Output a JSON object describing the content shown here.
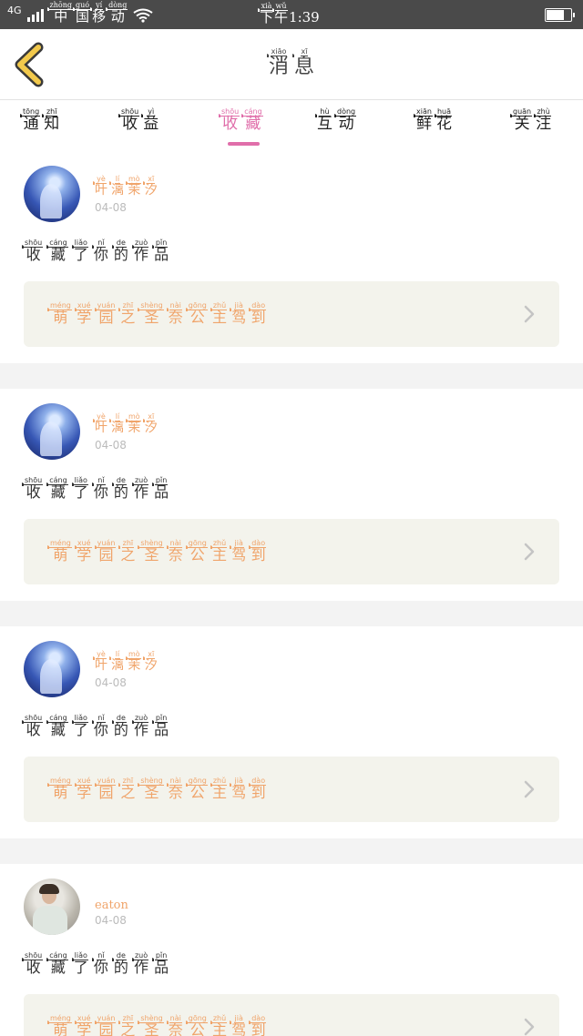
{
  "status_bar": {
    "network": "4G",
    "carrier": [
      {
        "py": "zhōng",
        "hz": "中"
      },
      {
        "py": "guó",
        "hz": "国"
      },
      {
        "py": "yí",
        "hz": "移"
      },
      {
        "py": "dòng",
        "hz": "动"
      }
    ],
    "time_prefix": [
      {
        "py": "xià",
        "hz": "下"
      },
      {
        "py": "wǔ",
        "hz": "午"
      }
    ],
    "time": "1:39",
    "battery_level": 0.75,
    "icons": [
      "signal-icon",
      "wifi-icon",
      "battery-icon"
    ]
  },
  "header": {
    "title": [
      {
        "py": "xiāo",
        "hz": "消"
      },
      {
        "py": "xī",
        "hz": "息"
      }
    ],
    "back_icon": "chevron-left-icon",
    "back_color": "#f2c94c"
  },
  "tabs": [
    {
      "id": "notice",
      "chars": [
        {
          "py": "tōng",
          "hz": "通"
        },
        {
          "py": "zhī",
          "hz": "知"
        }
      ]
    },
    {
      "id": "income",
      "chars": [
        {
          "py": "shōu",
          "hz": "收"
        },
        {
          "py": "yì",
          "hz": "益"
        }
      ]
    },
    {
      "id": "favorite",
      "active": true,
      "chars": [
        {
          "py": "shōu",
          "hz": "收"
        },
        {
          "py": "cáng",
          "hz": "藏"
        }
      ]
    },
    {
      "id": "interaction",
      "chars": [
        {
          "py": "hù",
          "hz": "互"
        },
        {
          "py": "dòng",
          "hz": "动"
        }
      ]
    },
    {
      "id": "flowers",
      "chars": [
        {
          "py": "xiān",
          "hz": "鲜"
        },
        {
          "py": "huā",
          "hz": "花"
        }
      ]
    },
    {
      "id": "follow",
      "chars": [
        {
          "py": "guān",
          "hz": "关"
        },
        {
          "py": "zhù",
          "hz": "注"
        }
      ]
    }
  ],
  "colors": {
    "accent": "#e06eaa",
    "name": "#f0a46a",
    "card_bg": "#f3f3ec",
    "status_bar": "#4a4a4a"
  },
  "feed": [
    {
      "avatar": "night-avatar",
      "user_chars": [
        {
          "py": "yè",
          "hz": "叶"
        },
        {
          "py": "lí",
          "hz": "漓"
        },
        {
          "py": "mò",
          "hz": "茉"
        },
        {
          "py": "xī",
          "hz": "汐"
        }
      ],
      "date": "04-08",
      "action_chars": [
        {
          "py": "shōu",
          "hz": "收"
        },
        {
          "py": "cáng",
          "hz": "藏"
        },
        {
          "py": "liǎo",
          "hz": "了"
        },
        {
          "py": "nǐ",
          "hz": "你"
        },
        {
          "py": "de",
          "hz": "的"
        },
        {
          "py": "zuò",
          "hz": "作"
        },
        {
          "py": "pǐn",
          "hz": "品"
        }
      ],
      "work_chars": [
        {
          "py": "méng",
          "hz": "萌"
        },
        {
          "py": "xué",
          "hz": "学"
        },
        {
          "py": "yuán",
          "hz": "园"
        },
        {
          "py": "zhī",
          "hz": "之"
        },
        {
          "py": "shèng",
          "hz": "圣"
        },
        {
          "py": "nài",
          "hz": "奈"
        },
        {
          "py": "gōng",
          "hz": "公"
        },
        {
          "py": "zhǔ",
          "hz": "主"
        },
        {
          "py": "jià",
          "hz": "驾"
        },
        {
          "py": "dào",
          "hz": "到"
        }
      ]
    },
    {
      "avatar": "night-avatar",
      "user_chars": [
        {
          "py": "yè",
          "hz": "叶"
        },
        {
          "py": "lí",
          "hz": "漓"
        },
        {
          "py": "mò",
          "hz": "茉"
        },
        {
          "py": "xī",
          "hz": "汐"
        }
      ],
      "date": "04-08",
      "action_chars": [
        {
          "py": "shōu",
          "hz": "收"
        },
        {
          "py": "cáng",
          "hz": "藏"
        },
        {
          "py": "liǎo",
          "hz": "了"
        },
        {
          "py": "nǐ",
          "hz": "你"
        },
        {
          "py": "de",
          "hz": "的"
        },
        {
          "py": "zuò",
          "hz": "作"
        },
        {
          "py": "pǐn",
          "hz": "品"
        }
      ],
      "work_chars": [
        {
          "py": "méng",
          "hz": "萌"
        },
        {
          "py": "xué",
          "hz": "学"
        },
        {
          "py": "yuán",
          "hz": "园"
        },
        {
          "py": "zhī",
          "hz": "之"
        },
        {
          "py": "shèng",
          "hz": "圣"
        },
        {
          "py": "nài",
          "hz": "奈"
        },
        {
          "py": "gōng",
          "hz": "公"
        },
        {
          "py": "zhǔ",
          "hz": "主"
        },
        {
          "py": "jià",
          "hz": "驾"
        },
        {
          "py": "dào",
          "hz": "到"
        }
      ]
    },
    {
      "avatar": "night-avatar",
      "user_chars": [
        {
          "py": "yè",
          "hz": "叶"
        },
        {
          "py": "lí",
          "hz": "漓"
        },
        {
          "py": "mò",
          "hz": "茉"
        },
        {
          "py": "xī",
          "hz": "汐"
        }
      ],
      "date": "04-08",
      "action_chars": [
        {
          "py": "shōu",
          "hz": "收"
        },
        {
          "py": "cáng",
          "hz": "藏"
        },
        {
          "py": "liǎo",
          "hz": "了"
        },
        {
          "py": "nǐ",
          "hz": "你"
        },
        {
          "py": "de",
          "hz": "的"
        },
        {
          "py": "zuò",
          "hz": "作"
        },
        {
          "py": "pǐn",
          "hz": "品"
        }
      ],
      "work_chars": [
        {
          "py": "méng",
          "hz": "萌"
        },
        {
          "py": "xué",
          "hz": "学"
        },
        {
          "py": "yuán",
          "hz": "园"
        },
        {
          "py": "zhī",
          "hz": "之"
        },
        {
          "py": "shèng",
          "hz": "圣"
        },
        {
          "py": "nài",
          "hz": "奈"
        },
        {
          "py": "gōng",
          "hz": "公"
        },
        {
          "py": "zhǔ",
          "hz": "主"
        },
        {
          "py": "jià",
          "hz": "驾"
        },
        {
          "py": "dào",
          "hz": "到"
        }
      ]
    },
    {
      "avatar": "photo-avatar",
      "user_text": "eaton",
      "date": "04-08",
      "action_chars": [
        {
          "py": "shōu",
          "hz": "收"
        },
        {
          "py": "cáng",
          "hz": "藏"
        },
        {
          "py": "liǎo",
          "hz": "了"
        },
        {
          "py": "nǐ",
          "hz": "你"
        },
        {
          "py": "de",
          "hz": "的"
        },
        {
          "py": "zuò",
          "hz": "作"
        },
        {
          "py": "pǐn",
          "hz": "品"
        }
      ],
      "work_chars": [
        {
          "py": "méng",
          "hz": "萌"
        },
        {
          "py": "xué",
          "hz": "学"
        },
        {
          "py": "yuán",
          "hz": "园"
        },
        {
          "py": "zhī",
          "hz": "之"
        },
        {
          "py": "shèng",
          "hz": "圣"
        },
        {
          "py": "nài",
          "hz": "奈"
        },
        {
          "py": "gōng",
          "hz": "公"
        },
        {
          "py": "zhǔ",
          "hz": "主"
        },
        {
          "py": "jià",
          "hz": "驾"
        },
        {
          "py": "dào",
          "hz": "到"
        }
      ]
    }
  ]
}
